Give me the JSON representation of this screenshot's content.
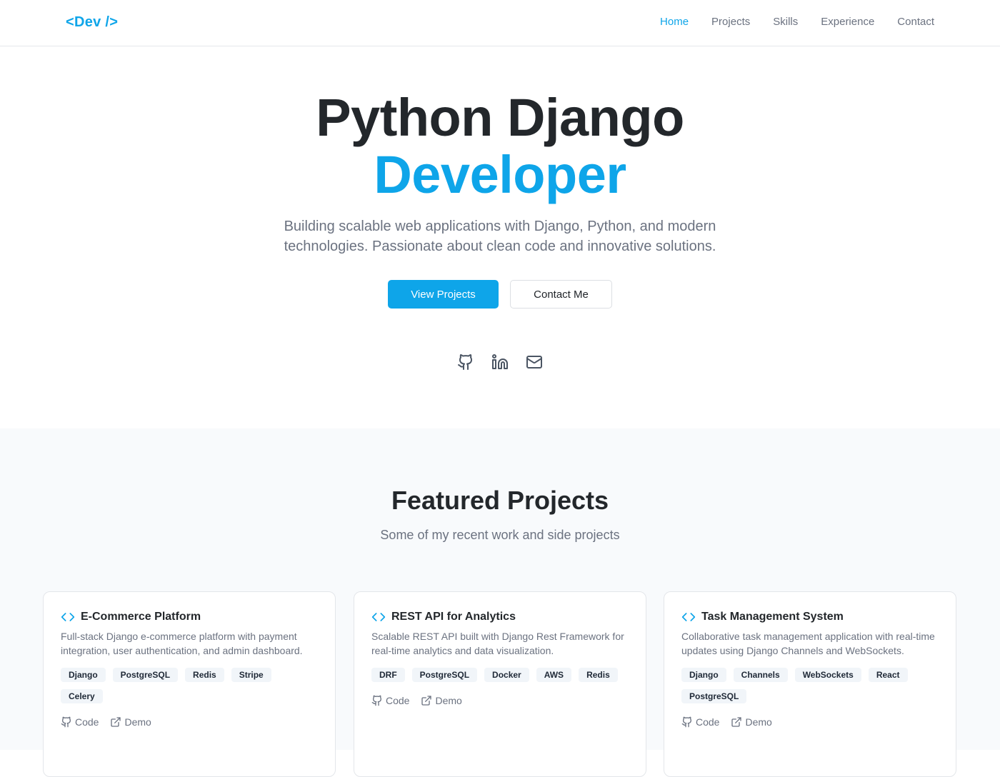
{
  "nav": {
    "logo": "<Dev />",
    "links": [
      "Home",
      "Projects",
      "Skills",
      "Experience",
      "Contact"
    ],
    "active": "Home"
  },
  "hero": {
    "title_line1": "Python Django",
    "title_line2": "Developer",
    "subtitle": "Building scalable web applications with Django, Python, and modern technologies. Passionate about clean code and innovative solutions.",
    "primary_button": "View Projects",
    "secondary_button": "Contact Me",
    "social_icons": [
      "github-icon",
      "linkedin-icon",
      "mail-icon"
    ]
  },
  "projects": {
    "title": "Featured Projects",
    "subtitle": "Some of my recent work and side projects",
    "cards": [
      {
        "title": "E-Commerce Platform",
        "description": "Full-stack Django e-commerce platform with payment integration, user authentication, and admin dashboard.",
        "tags": [
          "Django",
          "PostgreSQL",
          "Redis",
          "Stripe",
          "Celery"
        ],
        "code_label": "Code",
        "demo_label": "Demo"
      },
      {
        "title": "REST API for Analytics",
        "description": "Scalable REST API built with Django Rest Framework for real-time analytics and data visualization.",
        "tags": [
          "DRF",
          "PostgreSQL",
          "Docker",
          "AWS",
          "Redis"
        ],
        "code_label": "Code",
        "demo_label": "Demo"
      },
      {
        "title": "Task Management System",
        "description": "Collaborative task management application with real-time updates using Django Channels and WebSockets.",
        "tags": [
          "Django",
          "Channels",
          "WebSockets",
          "React",
          "PostgreSQL"
        ],
        "code_label": "Code",
        "demo_label": "Demo"
      }
    ]
  },
  "colors": {
    "accent": "#0ea5e9",
    "text": "#23272b",
    "muted": "#6b7280",
    "section_bg": "#f8fafc"
  }
}
